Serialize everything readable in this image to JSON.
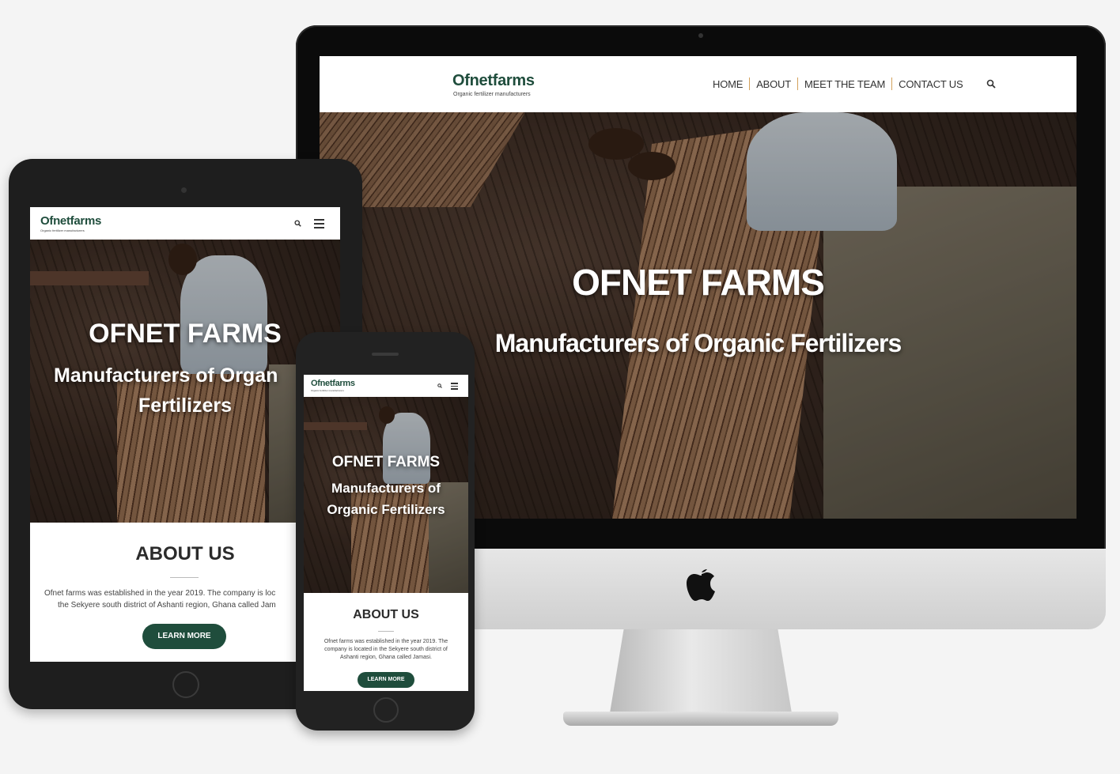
{
  "brand": {
    "name": "Ofnetfarms",
    "tagline": "Organic fertilizer manufacturers",
    "accent_color": "#1f4d3c"
  },
  "nav": {
    "items": [
      "HOME",
      "ABOUT",
      "MEET THE TEAM",
      "CONTACT US"
    ],
    "search_icon": "search-icon",
    "menu_icon": "hamburger-menu-icon"
  },
  "hero": {
    "title": "OFNET FARMS",
    "subtitle": "Manufacturers of Organic Fertilizers"
  },
  "tablet": {
    "hero_title": "OFNET FARMS",
    "hero_sub_line1": "Manufacturers of Organ",
    "hero_sub_line2": "Fertilizers",
    "about_title": "ABOUT US",
    "about_line1": "Ofnet farms was established in the year 2019. The company is loc",
    "about_line2": "the Sekyere south district of Ashanti region, Ghana called Jam",
    "button": "LEARN MORE"
  },
  "phone": {
    "hero_title": "OFNET FARMS",
    "hero_sub_line1": "Manufacturers of",
    "hero_sub_line2": "Organic Fertilizers",
    "about_title": "ABOUT US",
    "about_line1": "Ofnet farms was established in the year 2019. The",
    "about_line2": "company is located in the Sekyere south district of",
    "about_line3": "Ashanti region, Ghana called Jamasi.",
    "button": "LEARN MORE"
  }
}
